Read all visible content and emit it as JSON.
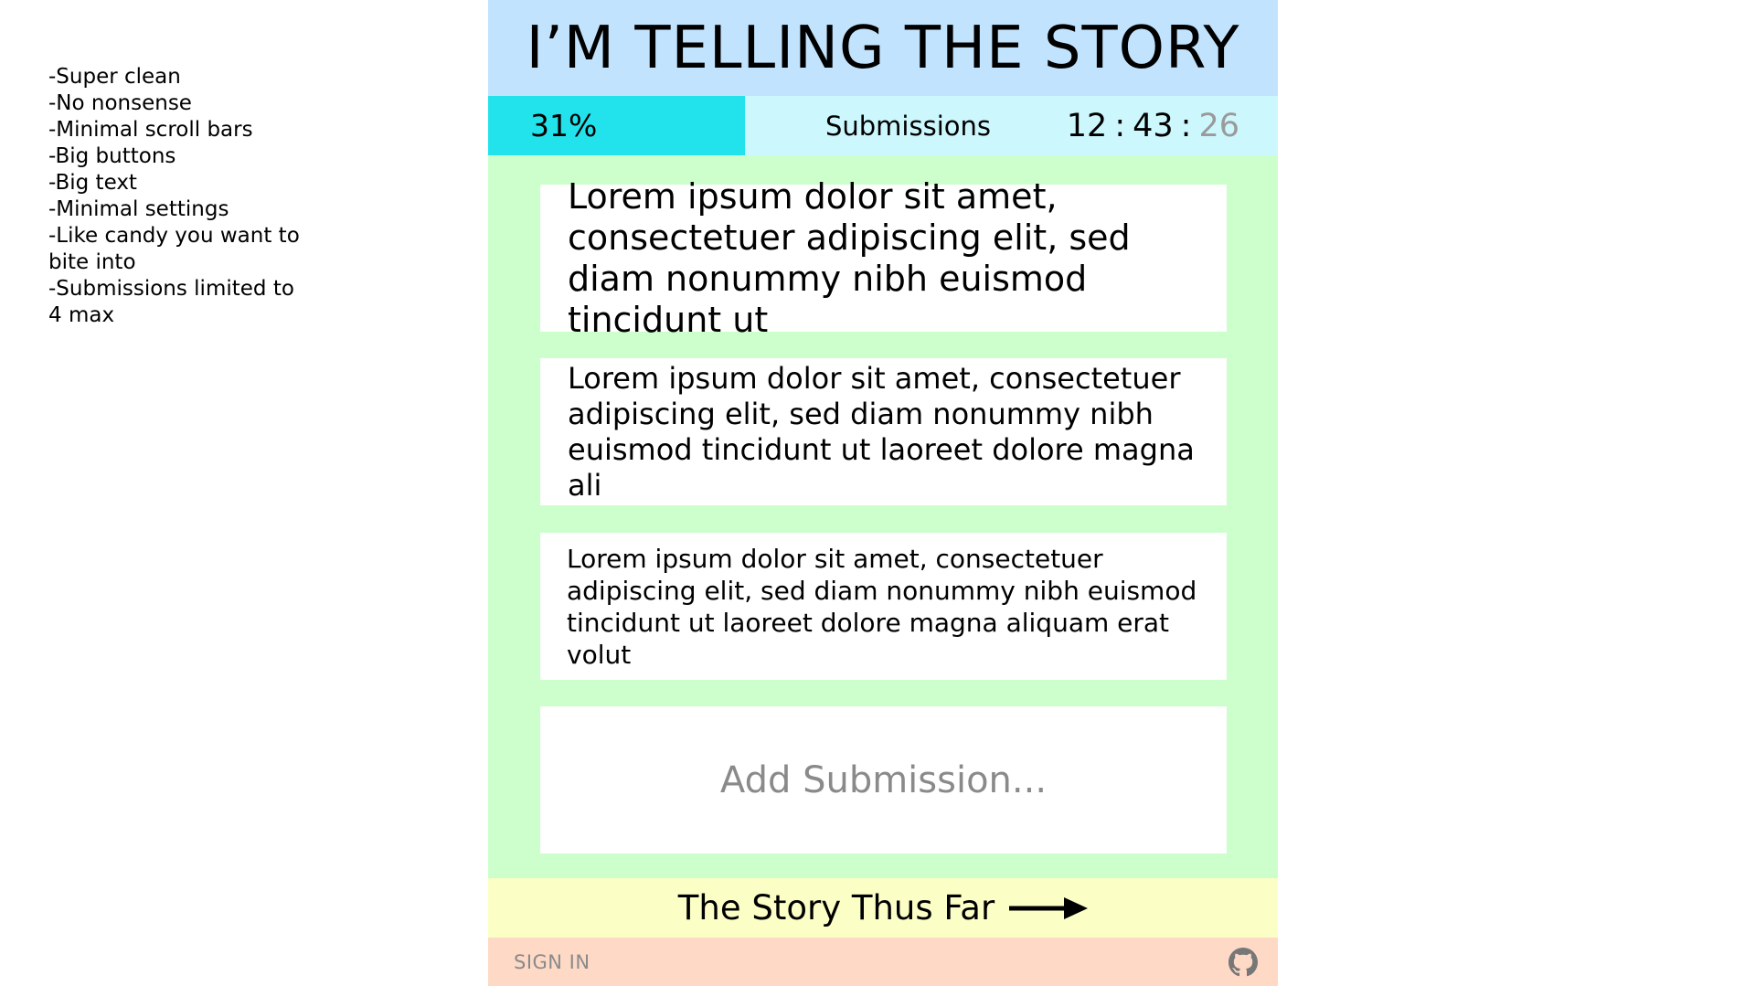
{
  "notes": [
    "-Super clean",
    "-No nonsense",
    "-Minimal scroll bars",
    "-Big buttons",
    "-Big text",
    "-Minimal settings",
    "-Like candy you want to",
    "bite into",
    "-Submissions limited to",
    "4 max"
  ],
  "header": {
    "title": "I’M TELLING THE STORY"
  },
  "status": {
    "progress_label": "31%",
    "progress_value": 0.31,
    "submissions_label": "Submissions",
    "timer": {
      "hours": "12",
      "minutes": "43",
      "seconds": "26",
      "separator": ":"
    }
  },
  "submissions": [
    "Lorem ipsum dolor sit amet, consectetuer adipiscing elit, sed diam nonummy nibh euismod tincidunt ut",
    "Lorem ipsum dolor sit amet, consectetuer adipiscing elit, sed diam nonummy nibh euismod tincidunt ut laoreet dolore magna ali",
    "Lorem ipsum dolor sit amet, consectetuer adipiscing elit, sed diam nonummy nibh euismod tincidunt ut laoreet dolore magna aliquam erat volut"
  ],
  "add_submission": {
    "placeholder": "Add Submission..."
  },
  "footer": {
    "story_link": "The Story Thus Far",
    "story_arrow_icon": "arrow-right-icon",
    "sign_in": "SIGN IN",
    "github_icon": "github-icon"
  },
  "colors": {
    "header_bg": "#c2e3fd",
    "progress_bg": "#22e3ec",
    "statusbar_bg": "#ccf7fd",
    "main_bg": "#ccffcc",
    "story_bar_bg": "#fbffc5",
    "bottom_bar_bg": "#fdd9c6"
  }
}
